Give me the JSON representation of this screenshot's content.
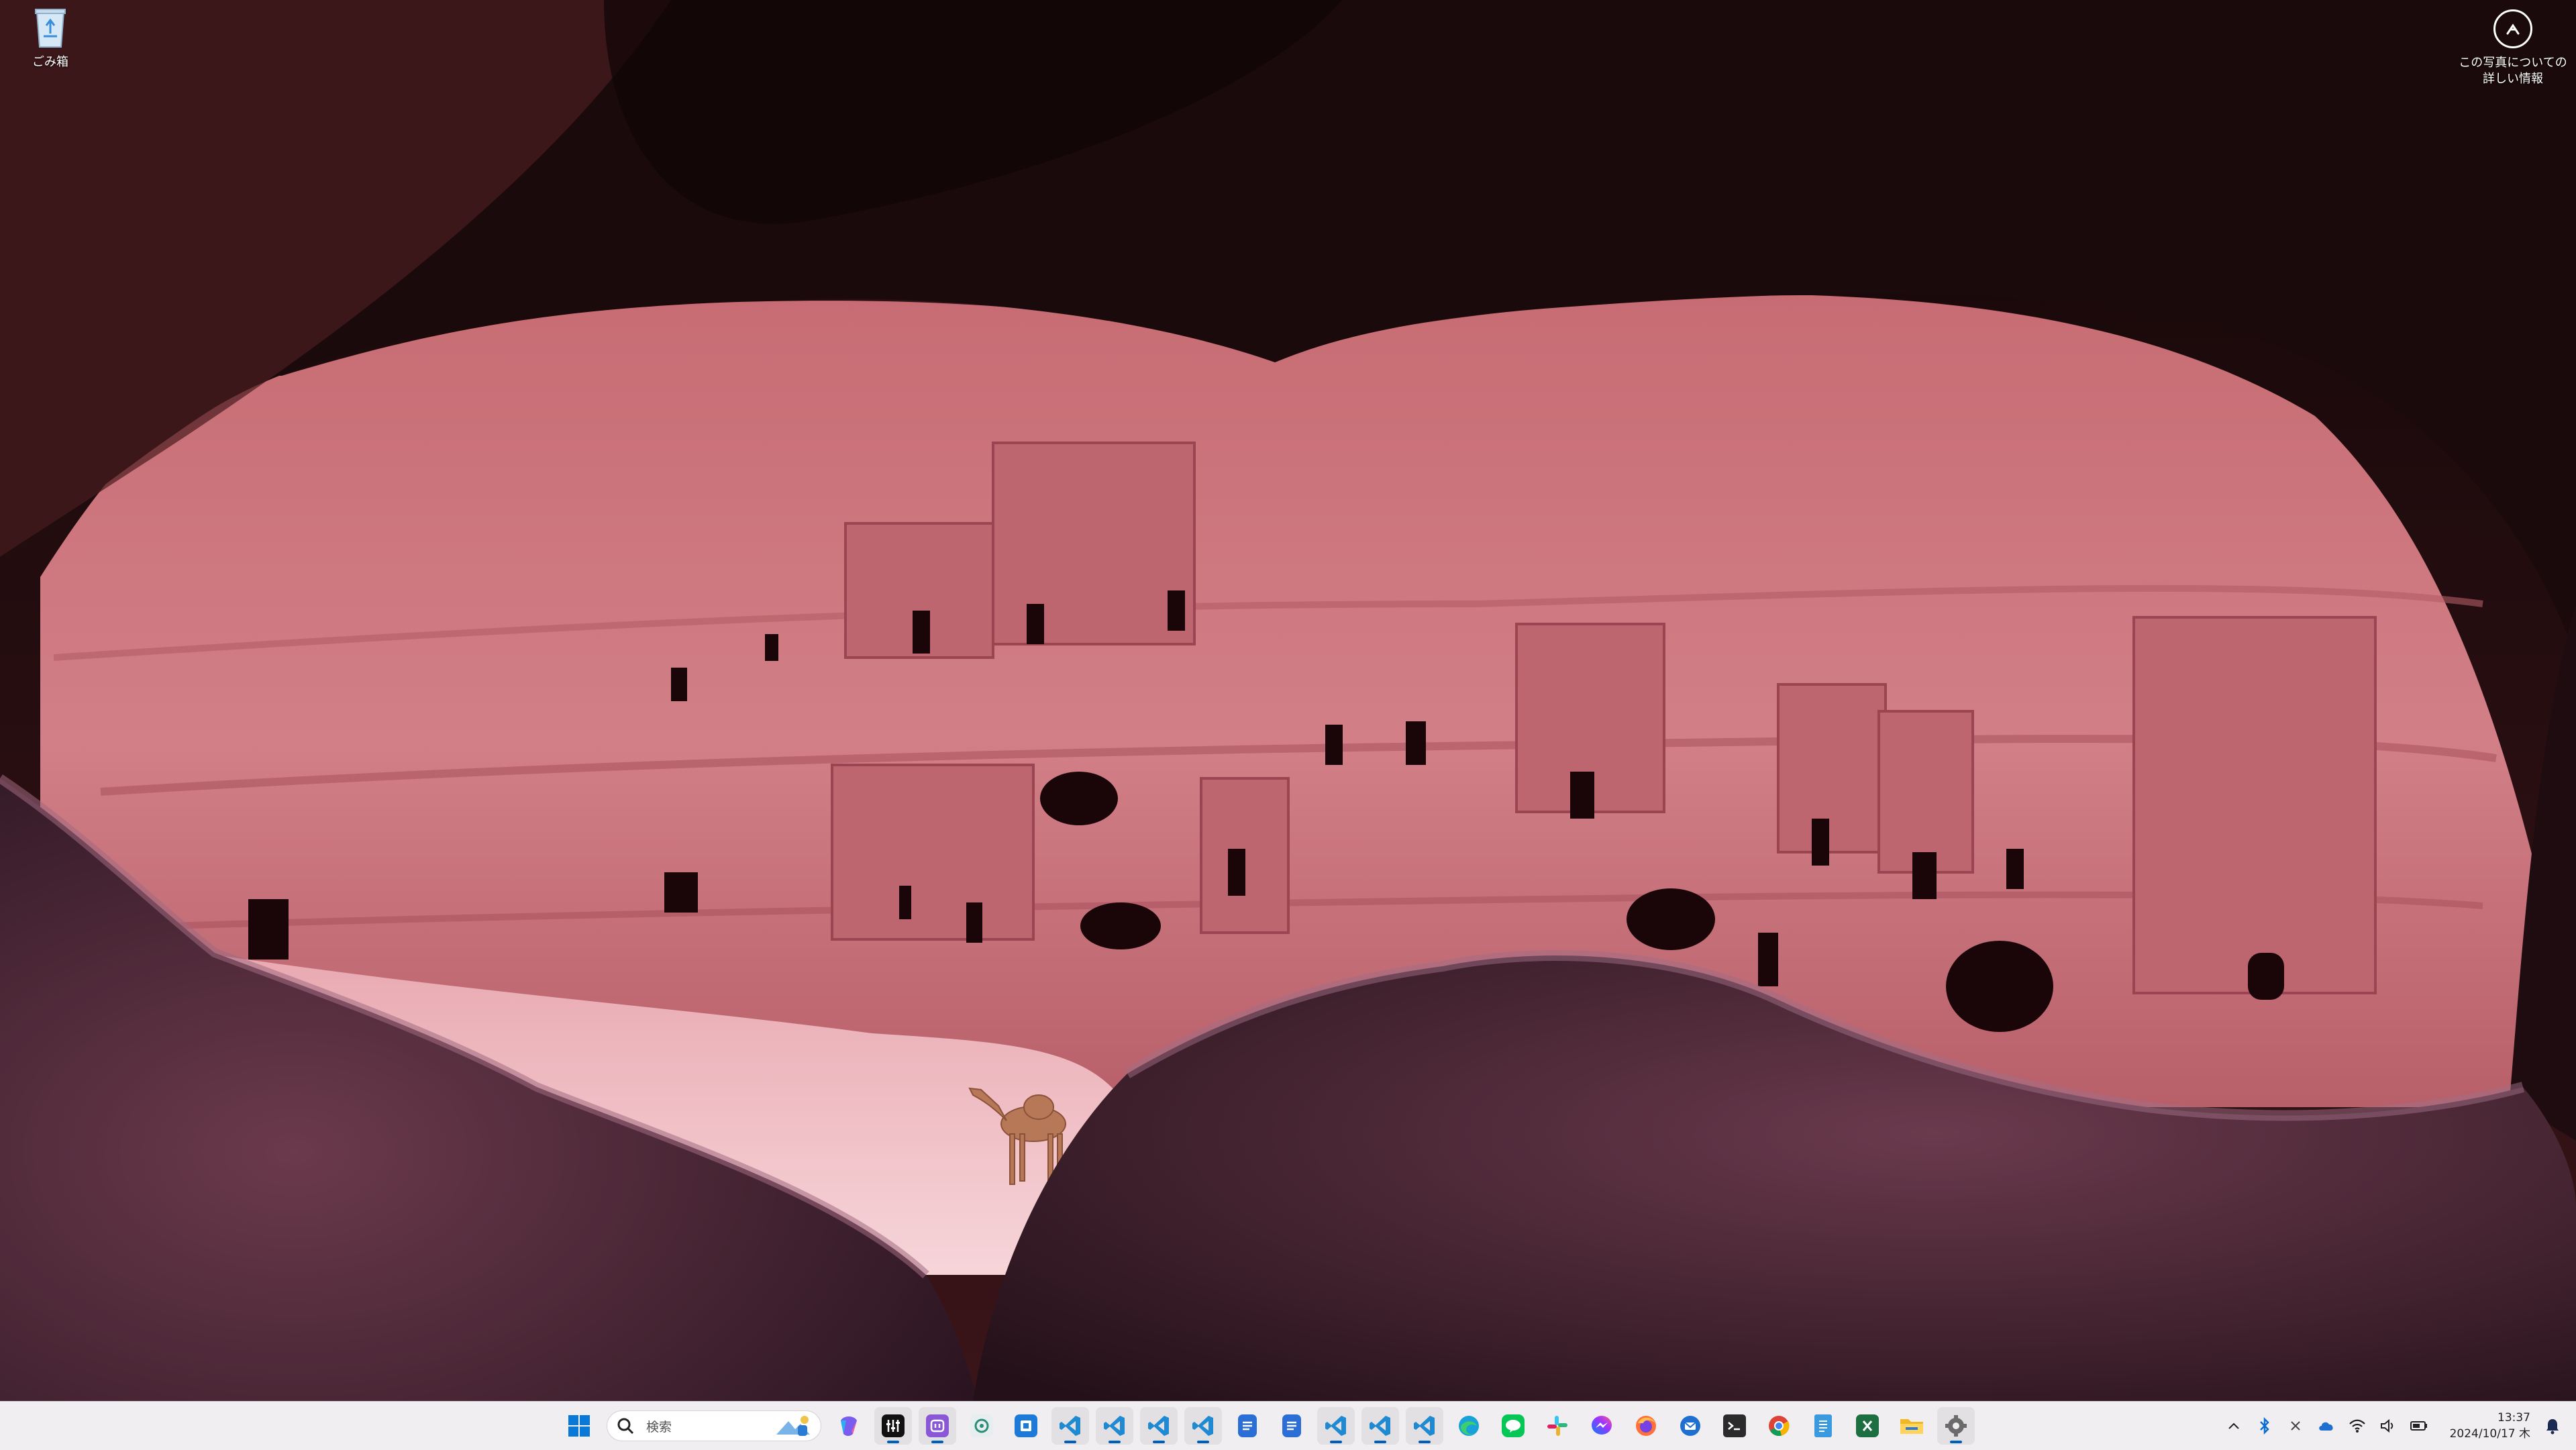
{
  "desktop": {
    "recycle_bin_label": "ごみ箱",
    "spotlight_label_line1": "この写真についての",
    "spotlight_label_line2": "詳しい情報"
  },
  "taskbar": {
    "search_placeholder": "検索",
    "pinned_apps": [
      {
        "name": "start-button",
        "icon": "windows-logo-icon",
        "active": false
      },
      {
        "name": "copilot",
        "icon": "copilot-icon",
        "active": false
      },
      {
        "name": "audio-mixer",
        "icon": "equalizer-icon",
        "active": true
      },
      {
        "name": "ai-assistant",
        "icon": "brain-icon",
        "active": true
      },
      {
        "name": "chatgpt",
        "icon": "openai-icon",
        "active": false
      },
      {
        "name": "app-blue-square",
        "icon": "blue-square-icon",
        "active": false
      },
      {
        "name": "vscode-1",
        "icon": "vscode-icon",
        "active": true
      },
      {
        "name": "vscode-2",
        "icon": "vscode-icon",
        "active": true
      },
      {
        "name": "vscode-3",
        "icon": "vscode-icon",
        "active": true
      },
      {
        "name": "vscode-4",
        "icon": "vscode-icon",
        "active": true
      },
      {
        "name": "docs-1",
        "icon": "document-icon",
        "active": false
      },
      {
        "name": "docs-2",
        "icon": "document-icon",
        "active": false
      },
      {
        "name": "vscode-5",
        "icon": "vscode-icon",
        "active": true
      },
      {
        "name": "vscode-6",
        "icon": "vscode-icon",
        "active": true
      },
      {
        "name": "vscode-7",
        "icon": "vscode-icon",
        "active": true
      },
      {
        "name": "edge",
        "icon": "edge-icon",
        "active": false
      },
      {
        "name": "line",
        "icon": "line-icon",
        "active": false
      },
      {
        "name": "slack",
        "icon": "slack-icon",
        "active": false
      },
      {
        "name": "messenger",
        "icon": "messenger-icon",
        "active": false
      },
      {
        "name": "firefox",
        "icon": "firefox-icon",
        "active": false
      },
      {
        "name": "thunderbird",
        "icon": "thunderbird-icon",
        "active": false
      },
      {
        "name": "terminal",
        "icon": "terminal-icon",
        "active": false
      },
      {
        "name": "chrome",
        "icon": "chrome-icon",
        "active": false
      },
      {
        "name": "notepad",
        "icon": "notepad-icon",
        "active": false
      },
      {
        "name": "excel",
        "icon": "excel-icon",
        "active": false
      },
      {
        "name": "file-explorer",
        "icon": "folder-icon",
        "active": false
      },
      {
        "name": "settings",
        "icon": "gear-icon",
        "active": true
      }
    ]
  },
  "tray": {
    "time": "13:37",
    "date": "2024/10/17 木"
  },
  "colors": {
    "taskbar_bg": "#f1eef2",
    "accent": "#005fb8",
    "vscode_blue": "#1f8ad2",
    "excel_green": "#1d6f42"
  }
}
